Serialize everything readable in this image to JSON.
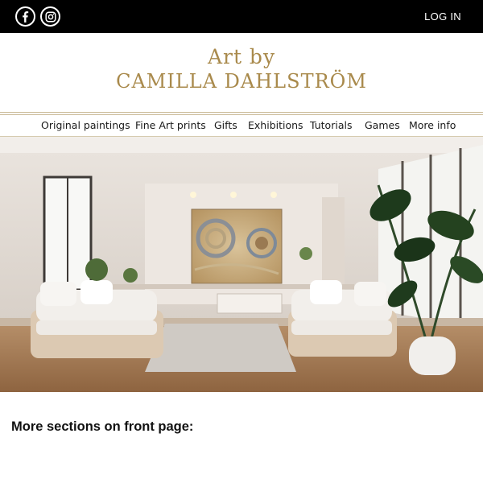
{
  "header": {
    "login_label": "LOG IN",
    "social_icons": [
      "facebook-icon",
      "instagram-icon"
    ]
  },
  "brand": {
    "line1": "Art by",
    "line2": "CAMILLA DAHLSTRÖM",
    "color": "#a98a4c"
  },
  "nav": {
    "items": [
      {
        "label": "Original paintings"
      },
      {
        "label": "Fine Art prints"
      },
      {
        "label": "Gifts"
      },
      {
        "label": "Exhibitions"
      },
      {
        "label": "Tutorials"
      },
      {
        "label": "Games"
      },
      {
        "label": "More info"
      }
    ]
  },
  "main": {
    "section_title": "More sections on front page:"
  }
}
